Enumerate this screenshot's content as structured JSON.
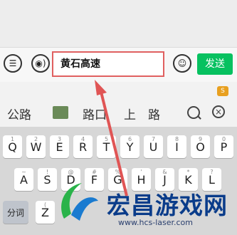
{
  "input_bar": {
    "menu_icon": "list-icon",
    "voice_icon": "voice-icon",
    "text_value": "黄石高速",
    "emoji_icon": "emoji-icon",
    "send_label": "发送",
    "send_color": "#07c160",
    "highlight_color": "#e06060"
  },
  "candidates": {
    "items": [
      "公路",
      "路口",
      "上",
      "路"
    ],
    "search_icon": "search-icon",
    "close_icon": "close-icon"
  },
  "keyboard": {
    "row1": [
      {
        "label": "Q",
        "sub": "1"
      },
      {
        "label": "W",
        "sub": "2"
      },
      {
        "label": "E",
        "sub": "3"
      },
      {
        "label": "R",
        "sub": "4"
      },
      {
        "label": "T",
        "sub": "5"
      },
      {
        "label": "Y",
        "sub": "6"
      },
      {
        "label": "U",
        "sub": "7"
      },
      {
        "label": "I",
        "sub": "8"
      },
      {
        "label": "O",
        "sub": "9"
      },
      {
        "label": "P",
        "sub": "0"
      }
    ],
    "row2": [
      {
        "label": "A",
        "sub": "~"
      },
      {
        "label": "S",
        "sub": "!"
      },
      {
        "label": "D",
        "sub": "@"
      },
      {
        "label": "F",
        "sub": "#"
      },
      {
        "label": "G",
        "sub": "%"
      },
      {
        "label": "H",
        "sub": "'"
      },
      {
        "label": "J",
        "sub": "&"
      },
      {
        "label": "K",
        "sub": "*"
      },
      {
        "label": "L",
        "sub": "?"
      }
    ],
    "row3_left": "分词",
    "row3_sub": "(",
    "row3_key": "Z"
  },
  "watermark": {
    "title": "宏昌游戏网",
    "url": "www.hcs-laser.com"
  }
}
